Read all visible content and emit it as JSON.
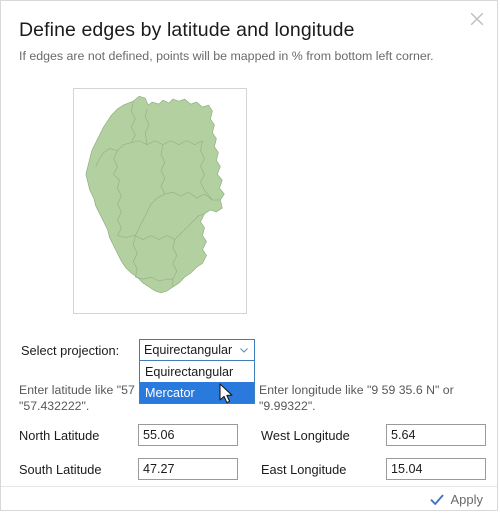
{
  "dialog": {
    "title": "Define edges by latitude and longitude",
    "subtitle": "If edges are not defined, points will be mapped in % from bottom left corner.",
    "close_label": "✕"
  },
  "map": {
    "name": "germany-map",
    "fill_color": "#b3d0a1",
    "border_color": "#8fae80",
    "frame_color": "#d4d4d4"
  },
  "projection": {
    "label": "Select projection:",
    "selected": "Equirectangular",
    "expanded": true,
    "options": [
      {
        "label": "Equirectangular",
        "highlighted": false
      },
      {
        "label": "Mercator",
        "highlighted": true
      }
    ],
    "highlight_color": "#2a7ade",
    "border_color": "#3d7ebd"
  },
  "hints": {
    "latitude": "Enter latitude like \"57 25 56.0 N\" or \"57.432222\".",
    "longitude": "Enter longitude like \"9 59 35.6 N\" or \"9.99322\"."
  },
  "fields": {
    "north": {
      "label": "North Latitude",
      "value": "55.06"
    },
    "south": {
      "label": "South Latitude",
      "value": "47.27"
    },
    "west": {
      "label": "West Longitude",
      "value": "5.64"
    },
    "east": {
      "label": "East Longitude",
      "value": "15.04"
    }
  },
  "footer": {
    "apply_label": "Apply",
    "apply_check_color": "#4472c4"
  }
}
